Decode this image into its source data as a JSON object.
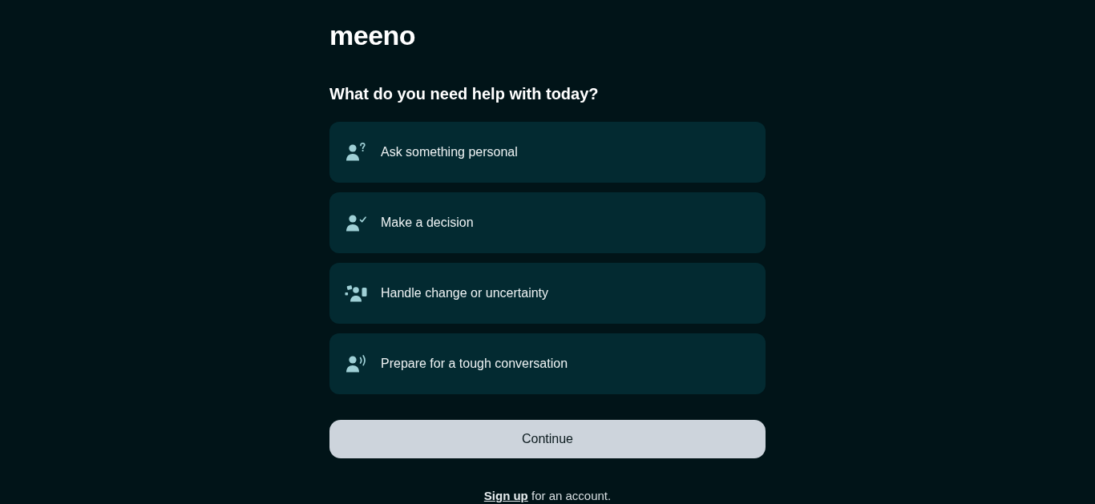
{
  "logo": "meeno",
  "heading": "What do you need help with today?",
  "options": [
    {
      "label": "Ask something personal",
      "selected": false
    },
    {
      "label": "Make a decision",
      "selected": false
    },
    {
      "label": "Handle change or uncertainty",
      "selected": false
    },
    {
      "label": "Prepare for a tough conversation",
      "selected": false
    }
  ],
  "continue_button": "Continue",
  "signup": {
    "link": "Sign up",
    "text": "for an account."
  }
}
